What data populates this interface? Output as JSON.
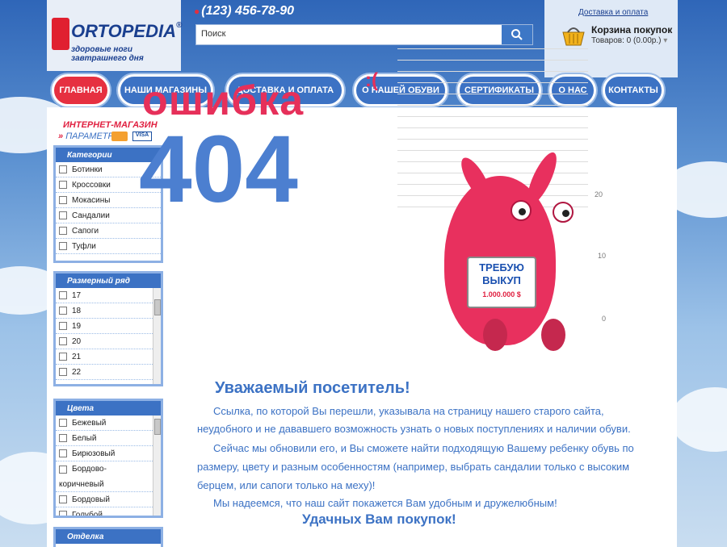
{
  "header": {
    "logo_text": "ORTOPEDIA",
    "logo_reg": "®",
    "logo_tagline": "здоровые ноги завтрашнего дня",
    "phone": "(123) 456-78-90"
  },
  "search": {
    "placeholder": "Поиск",
    "value": "Поиск"
  },
  "cart": {
    "delivery_link": "Доставка и оплата",
    "title": "Корзина покупок",
    "items": "Товаров: 0 (0.00р.)"
  },
  "nav": {
    "items": [
      {
        "label": "ГЛАВНАЯ"
      },
      {
        "label": "НАШИ МАГАЗИНЫ"
      },
      {
        "label": "ДОСТАВКА И ОПЛАТА"
      },
      {
        "label": "О НАШЕЙ ОБУВИ"
      },
      {
        "label": "СЕРТИФИКАТЫ"
      },
      {
        "label": "О НАС"
      },
      {
        "label": "КОНТАКТЫ"
      }
    ]
  },
  "sidebar": {
    "shop_label": "ИНТЕРНЕТ-МАГАЗИН",
    "params_prefix": "»",
    "params_label": "ПАРАМЕТРЫ",
    "visa": "VISA",
    "categories": {
      "title": "Категории",
      "items": [
        "Ботинки",
        "Кроссовки",
        "Мокасины",
        "Сандалии",
        "Сапоги",
        "Туфли"
      ]
    },
    "sizes": {
      "title": "Размерный ряд",
      "items": [
        "17",
        "18",
        "19",
        "20",
        "21",
        "22"
      ]
    },
    "colors": {
      "title": "Цвета",
      "items": [
        "Бежевый",
        "Белый",
        "Бирюзовый",
        "Бордово-",
        "коричневый",
        "Бордовый",
        "Голубой"
      ]
    },
    "finish": {
      "title": "Отделка"
    }
  },
  "error": {
    "word": "ошибка",
    "sad": ":(",
    "code": "404",
    "sign_line1": "ТРЕБУЮ",
    "sign_line2": "ВЫКУП",
    "sign_amount": "1.000.000 $",
    "scale": [
      "20",
      "10",
      "0"
    ]
  },
  "message": {
    "title": "Уважаемый посетитель!",
    "p1a": "Ссылка, по которой Вы перешли, указывала на страницу нашего старого сайта,",
    "p1b": "неудобного и не дававшего возможность узнать о новых поступлениях и наличии обуви.",
    "p2a": "Сейчас мы обновили его, и Вы сможете найти подходящую Вашему ребенку обувь по",
    "p2b": "размеру, цвету и разным особенностям (например, выбрать сандалии только с высоким",
    "p2c": "берцем, или сапоги только на меху)!",
    "p3": "Мы надеемся, что наш сайт покажется Вам удобным и дружелюбным!",
    "closing": "Удачных Вам покупок!"
  },
  "colors": {
    "accent_blue": "#3c72c4",
    "accent_red": "#e6305a",
    "nav_active": "#e63040"
  }
}
